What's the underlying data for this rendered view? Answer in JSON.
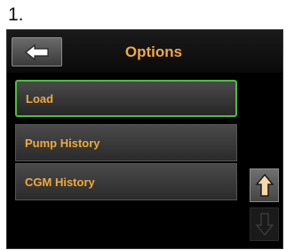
{
  "step": {
    "label": "1."
  },
  "header": {
    "title": "Options",
    "back_icon": "back-arrow-icon"
  },
  "menu": {
    "items": [
      {
        "label": "Load",
        "selected": true
      },
      {
        "label": "Pump History",
        "selected": false
      },
      {
        "label": "CGM History",
        "selected": false
      }
    ]
  },
  "scroll": {
    "up_icon": "up-arrow-icon",
    "down_icon": "down-arrow-icon",
    "up_enabled": true,
    "down_enabled": false
  },
  "colors": {
    "accent_text": "#f2a93b",
    "selection_border": "#4bbf3b",
    "up_arrow_fill": "#f7d8a8"
  }
}
